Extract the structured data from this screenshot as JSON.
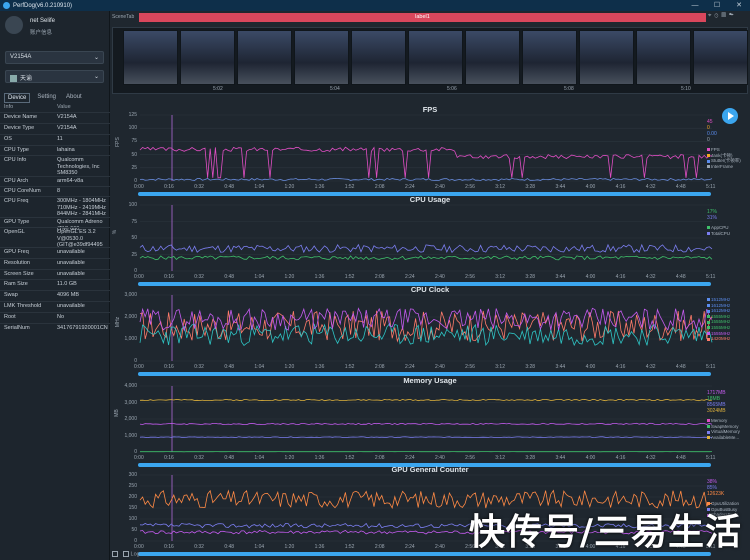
{
  "app": {
    "title": "PerfDog(v6.0.210910)"
  },
  "window_controls": {
    "minimize": "—",
    "maximize": "☐",
    "close": "✕"
  },
  "user": {
    "name": "net Selife",
    "sub": "账户信息"
  },
  "device_select": {
    "value": "V2154A"
  },
  "app_select": {
    "value": "天谕"
  },
  "tabs": [
    "Device",
    "Setting",
    "About"
  ],
  "table": {
    "headers": [
      "Info",
      "Value"
    ],
    "rows": [
      {
        "k": "Device Name",
        "v": "V2154A"
      },
      {
        "k": "Device Type",
        "v": "V2154A"
      },
      {
        "k": "OS",
        "v": "11"
      },
      {
        "k": "CPU Type",
        "v": "lahaina"
      },
      {
        "k": "CPU Info",
        "v": "Qualcomm Technologies, Inc SM8350"
      },
      {
        "k": "CPU Arch",
        "v": "arm64-v8a"
      },
      {
        "k": "CPU CoreNum",
        "v": "8"
      },
      {
        "k": "CPU Freq",
        "v": "300MHz - 1804MHz 710MHz - 2419MHz 844MHz - 2841MHz"
      },
      {
        "k": "GPU Type",
        "v": "Qualcomm Adreno (TM) 660"
      },
      {
        "k": "OpenGL",
        "v": "OpenGL ES 3.2 V@0530.0 (GIT@e39df94495"
      },
      {
        "k": "GPU Freq",
        "v": "unavailable"
      },
      {
        "k": "Resolution",
        "v": "unavailable"
      },
      {
        "k": "Screen Size",
        "v": "unavailable"
      },
      {
        "k": "Ram Size",
        "v": "11.0 GB"
      },
      {
        "k": "Swap",
        "v": "4096 MB"
      },
      {
        "k": "LMK Threshold",
        "v": "unavailable"
      },
      {
        "k": "Root",
        "v": "No"
      },
      {
        "k": "SerialNum",
        "v": "34176791920001CN"
      }
    ]
  },
  "scene": {
    "tab_label": "SceneTab",
    "label": "label1",
    "thumb_times": [
      "5:02",
      "5:04",
      "5:06",
      "5:08",
      "5:10"
    ]
  },
  "time_ticks": [
    "0:00",
    "0:16",
    "0:32",
    "0:48",
    "1:04",
    "1:20",
    "1:36",
    "1:52",
    "2:08",
    "2:24",
    "2:40",
    "2:56",
    "3:12",
    "3:28",
    "3:44",
    "4:00",
    "4:16",
    "4:32",
    "4:48",
    "5:11"
  ],
  "bottom": {
    "log": "Log"
  },
  "watermark": "快传号/三易生活",
  "colors": {
    "accent": "#3ba6ef",
    "fps": "#e04fc4",
    "appcpu": "#7b7ef0",
    "totalcpu": "#3fbf6a",
    "mem": "#e0b33c",
    "gpu": "#ff8a45"
  },
  "panels": [
    {
      "title": "FPS",
      "unit": "FPS",
      "yticks": [
        "125",
        "100",
        "75",
        "50",
        "25",
        "0"
      ],
      "ymax": 125,
      "legend": [
        "FPS",
        "Jank(卡顿)",
        "Stutter(卡顿率)",
        "InterFrame"
      ],
      "legend_colors": [
        "#e04fc4",
        "#f5a623",
        "#5b8def",
        "#9aa5b0"
      ],
      "vals": [
        "45",
        "0",
        "0.00",
        "0"
      ],
      "val_colors": [
        "#e04fc4",
        "#f5a623",
        "#5b8def",
        "#9aa5b0"
      ],
      "series": [
        {
          "color": "#e04fc4",
          "base": 60,
          "amp": 4,
          "seed": 3,
          "dips": true,
          "after": 46
        },
        {
          "color": "#6a8dde",
          "base": 3,
          "amp": 2,
          "seed": 7
        }
      ]
    },
    {
      "title": "CPU Usage",
      "unit": "%",
      "yticks": [
        "100",
        "75",
        "50",
        "25",
        "0"
      ],
      "ymax": 100,
      "legend": [
        "AppCPU",
        "TotalCPU"
      ],
      "legend_colors": [
        "#3fbf6a",
        "#7b7ef0"
      ],
      "vals": [
        "17%",
        "31%"
      ],
      "val_colors": [
        "#3fbf6a",
        "#7b7ef0"
      ],
      "series": [
        {
          "color": "#7b7ef0",
          "base": 34,
          "amp": 6,
          "seed": 11
        },
        {
          "color": "#3fbf6a",
          "base": 20,
          "amp": 3,
          "seed": 5
        }
      ]
    },
    {
      "title": "CPU Clock",
      "unit": "MHz",
      "yticks": [
        "3,000",
        "2,000",
        "1,000",
        "0"
      ],
      "ymax": 3000,
      "legend": [
        "1512MHz",
        "1612MHz",
        "1612MHz",
        "1555MHz",
        "1555MHz",
        "1555MHz",
        "1555MHz",
        "1420MHz"
      ],
      "legend_colors": [
        "#5b8def",
        "#5b8def",
        "#5b8def",
        "#3fbf6a",
        "#3fbf6a",
        "#3fbf6a",
        "#c45bef",
        "#ff7b6a"
      ],
      "vals": [],
      "val_colors": [],
      "series": [
        {
          "color": "#ff7b6a",
          "base": 1600,
          "amp": 700,
          "seed": 17
        },
        {
          "color": "#2ec4c4",
          "base": 1200,
          "amp": 500,
          "seed": 23
        },
        {
          "color": "#c45bef",
          "base": 1900,
          "amp": 500,
          "seed": 29
        }
      ]
    },
    {
      "title": "Memory Usage",
      "unit": "MB",
      "yticks": [
        "4,000",
        "3,000",
        "2,000",
        "1,000",
        "0"
      ],
      "ymax": 4000,
      "legend": [
        "Memory",
        "SwapMemory",
        "VirtualMemory",
        "AvailableMe..."
      ],
      "legend_colors": [
        "#e04fc4",
        "#3fbf6a",
        "#7b7ef0",
        "#e0b33c"
      ],
      "vals": [
        "1717MB",
        "18MB",
        "8565MB",
        "3024MB"
      ],
      "val_colors": [
        "#c45bef",
        "#3fbf6a",
        "#7b7ef0",
        "#e0b33c"
      ],
      "series": [
        {
          "color": "#e0b33c",
          "base": 3150,
          "amp": 40,
          "seed": 2
        },
        {
          "color": "#c45bef",
          "base": 1700,
          "amp": 40,
          "seed": 4
        },
        {
          "color": "#7b7ef0",
          "base": 900,
          "amp": 20,
          "seed": 6
        },
        {
          "color": "#3fbf6a",
          "base": 20,
          "amp": 5,
          "seed": 8
        }
      ]
    },
    {
      "title": "GPU General Counter",
      "unit": "",
      "yticks": [
        "300",
        "250",
        "200",
        "150",
        "100",
        "50",
        "0"
      ],
      "ymax": 300,
      "legend": [
        "GpuUtilization",
        "GpuBusBusy",
        "ShadersBusy"
      ],
      "legend_colors": [
        "#ff8a45",
        "#7b7ef0",
        "#c45bef"
      ],
      "vals": [
        "38%",
        "85%",
        "12623K"
      ],
      "val_colors": [
        "#c45bef",
        "#7b7ef0",
        "#ff8a45"
      ],
      "series": [
        {
          "color": "#ff8a45",
          "base": 190,
          "amp": 40,
          "seed": 31
        },
        {
          "color": "#7b7ef0",
          "base": 70,
          "amp": 10,
          "seed": 37
        },
        {
          "color": "#c45bef",
          "base": 40,
          "amp": 8,
          "seed": 41
        }
      ]
    }
  ]
}
